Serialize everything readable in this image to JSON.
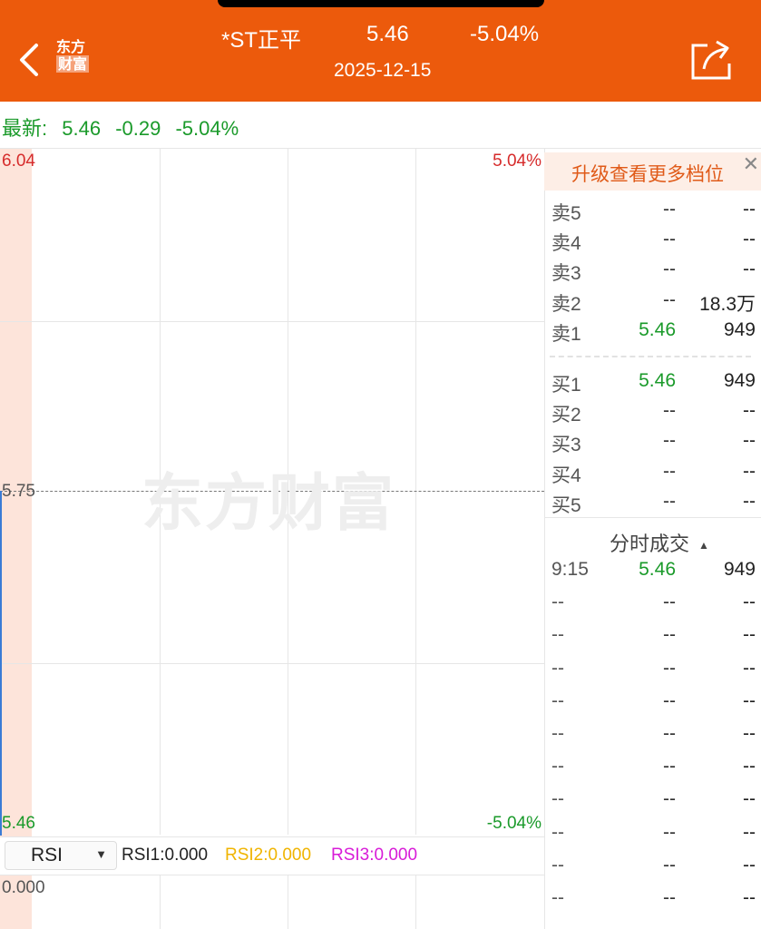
{
  "header": {
    "name": "*ST正平",
    "price": "5.46",
    "change_pct": "-5.04%",
    "date": "2025-12-15",
    "logo_line1": "东方",
    "logo_line2": "财富",
    "back_icon": "chevron-left-icon",
    "share_icon": "share-icon"
  },
  "latest": {
    "label": "最新:",
    "price": "5.46",
    "change": "-0.29",
    "pct": "-5.04%"
  },
  "chart": {
    "high": "6.04",
    "mid": "5.75",
    "low": "5.46",
    "high_pct": "5.04%",
    "low_pct": "-5.04%",
    "watermark": "东方财富",
    "indicator": "RSI",
    "rsi1": "RSI1:0.000",
    "rsi2": "RSI2:0.000",
    "rsi3": "RSI3:0.000",
    "rsi_axis": "0.000",
    "colors": {
      "up": "#d62b2b",
      "down": "#1a9a2a",
      "rsi2": "#f0b400",
      "rsi3": "#d81bd8",
      "accent": "#ec5a0c"
    }
  },
  "book": {
    "upgrade": "升级查看更多档位",
    "close_icon": "close-icon",
    "sell": [
      {
        "label": "卖5",
        "price": "--",
        "vol": "--"
      },
      {
        "label": "卖4",
        "price": "--",
        "vol": "--"
      },
      {
        "label": "卖3",
        "price": "--",
        "vol": "--"
      },
      {
        "label": "卖2",
        "price": "--",
        "vol": "18.3万"
      },
      {
        "label": "卖1",
        "price": "5.46",
        "vol": "949"
      }
    ],
    "buy": [
      {
        "label": "买1",
        "price": "5.46",
        "vol": "949"
      },
      {
        "label": "买2",
        "price": "--",
        "vol": "--"
      },
      {
        "label": "买3",
        "price": "--",
        "vol": "--"
      },
      {
        "label": "买4",
        "price": "--",
        "vol": "--"
      },
      {
        "label": "买5",
        "price": "--",
        "vol": "--"
      }
    ]
  },
  "ticks": {
    "title": "分时成交",
    "sort_icon": "triangle-up-icon",
    "rows": [
      {
        "time": "9:15",
        "price": "5.46",
        "vol": "949"
      },
      {
        "time": "--",
        "price": "--",
        "vol": "--"
      },
      {
        "time": "--",
        "price": "--",
        "vol": "--"
      },
      {
        "time": "--",
        "price": "--",
        "vol": "--"
      },
      {
        "time": "--",
        "price": "--",
        "vol": "--"
      },
      {
        "time": "--",
        "price": "--",
        "vol": "--"
      },
      {
        "time": "--",
        "price": "--",
        "vol": "--"
      },
      {
        "time": "--",
        "price": "--",
        "vol": "--"
      },
      {
        "time": "--",
        "price": "--",
        "vol": "--"
      },
      {
        "time": "--",
        "price": "--",
        "vol": "--"
      },
      {
        "time": "--",
        "price": "--",
        "vol": "--"
      }
    ]
  }
}
